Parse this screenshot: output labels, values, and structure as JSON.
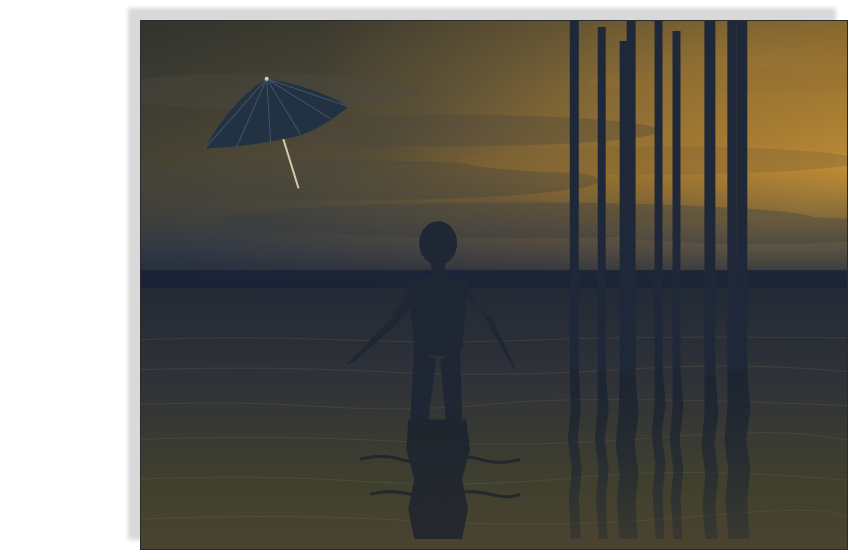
{
  "scene": {
    "subject": "child-silhouette",
    "objects": [
      "umbrella-icon",
      "posts",
      "sea",
      "cloudy-sky"
    ],
    "colors": {
      "sky_top": "#3a3b33",
      "sky_glow": "#c98f2e",
      "sky_mid": "#6e5d38",
      "horizon": "#1c2638",
      "water_top": "#2a2f36",
      "water_bottom": "#4a4530",
      "silhouette": "#1f2734",
      "umbrella_canopy": "#233344",
      "umbrella_stick": "#d8c9a8"
    }
  }
}
